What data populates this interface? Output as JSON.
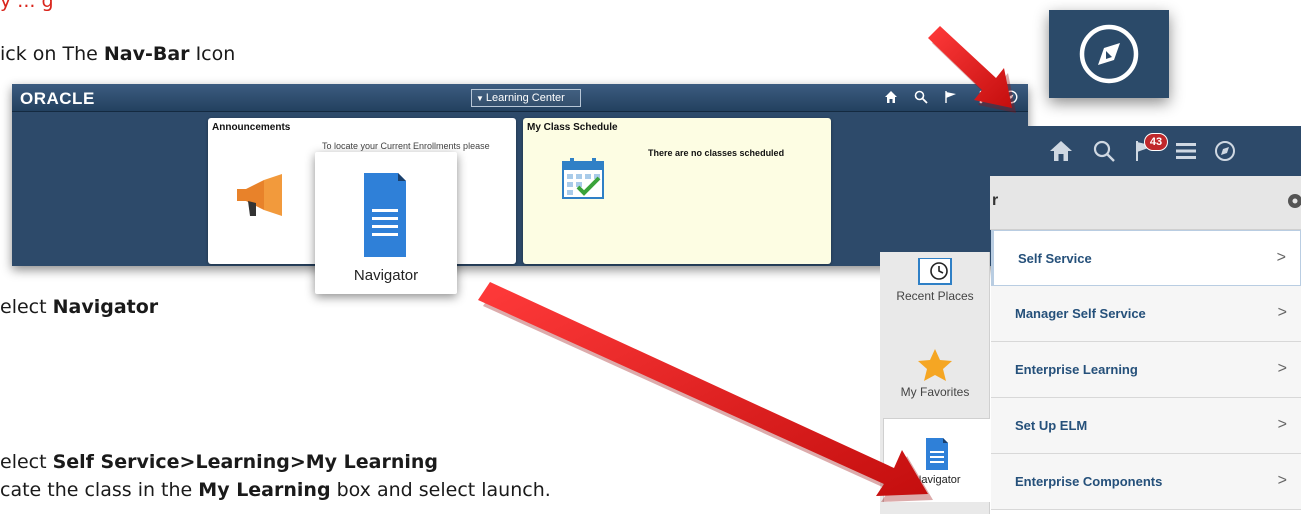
{
  "doc": {
    "top_red_text": "y ... g",
    "step_click": "ick on The ",
    "step_click_bold": "Nav-Bar",
    "step_click_tail": " Icon",
    "step_select": "elect ",
    "step_select_bold": "Navigator",
    "step_path": "elect ",
    "step_path_bold": "Self Service>Learning>My Learning",
    "step_locate": "cate the class in the ",
    "step_locate_bold": "My Learning",
    "step_locate_tail": " box and select launch."
  },
  "screenshot": {
    "logo": "ORACLE",
    "center_select": "Learning Center",
    "bar_icons": [
      "home-icon",
      "search-icon",
      "flag-icon",
      "more-icon",
      "compass-icon"
    ],
    "tiles": {
      "announcements_title": "Announcements",
      "announcements_text": "To locate your Current Enrollments please",
      "schedule_title": "My Class Schedule",
      "schedule_text": "There are no classes scheduled"
    }
  },
  "navigator_popup": {
    "label": "Navigator"
  },
  "nav_panel": {
    "badge": "43",
    "header": "r",
    "left_items": [
      "Recent Places",
      "My Favorites",
      "Navigator"
    ],
    "menu": [
      "Self Service",
      "Manager Self Service",
      "Enterprise Learning",
      "Set Up ELM",
      "Enterprise Components"
    ],
    "chevron": ">"
  },
  "colors": {
    "nav_blue": "#2d4a6a",
    "arrow_red": "#e01b1b",
    "menu_text": "#25507a"
  }
}
